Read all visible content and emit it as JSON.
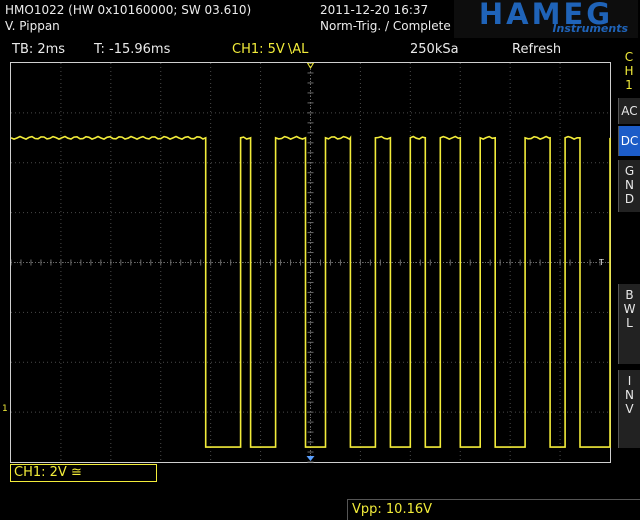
{
  "header": {
    "device": "HMO1022 (HW 0x10160000; SW 03.610)",
    "user": "V. Pippan",
    "datetime": "2011-12-20 16:37",
    "trigger_mode": "Norm-Trig. / Complete",
    "logo": "HAMEG",
    "logo_sub": "Instruments"
  },
  "infobar": {
    "timebase": "TB: 2ms",
    "time_offset": "T: -15.96ms",
    "ch1_trigger": "CH1: 5V",
    "trigger_slope": "\\AL",
    "sample_rate": "250kSa",
    "mode": "Refresh"
  },
  "side_menu": {
    "ch_label": [
      "C",
      "H",
      "1"
    ],
    "ac": "AC",
    "dc": "DC",
    "gnd": [
      "G",
      "N",
      "D"
    ],
    "bwl": [
      "B",
      "W",
      "L"
    ],
    "inv": [
      "I",
      "N",
      "V"
    ]
  },
  "channel": {
    "label": "CH1: 2V",
    "coupling_symbol": "≅",
    "marker": "1",
    "trigger_marker": "T"
  },
  "measurement": {
    "vpp": "Vpp: 10.16V"
  },
  "colors": {
    "trace": "#f2ec3a",
    "accent": "#1c5cc8",
    "grid": "#4a4a4a"
  },
  "waveform": {
    "high_level_div": 2.5,
    "low_level_div": -3.7,
    "pulses_div": [
      [
        3.9,
        4.6
      ],
      [
        4.8,
        5.3
      ],
      [
        5.9,
        6.3
      ],
      [
        6.8,
        7.3
      ],
      [
        7.6,
        8.0
      ],
      [
        8.3,
        8.6
      ],
      [
        9.0,
        9.4
      ],
      [
        9.7,
        10.3
      ],
      [
        10.8,
        11.1
      ],
      [
        11.4,
        12.0
      ]
    ]
  }
}
